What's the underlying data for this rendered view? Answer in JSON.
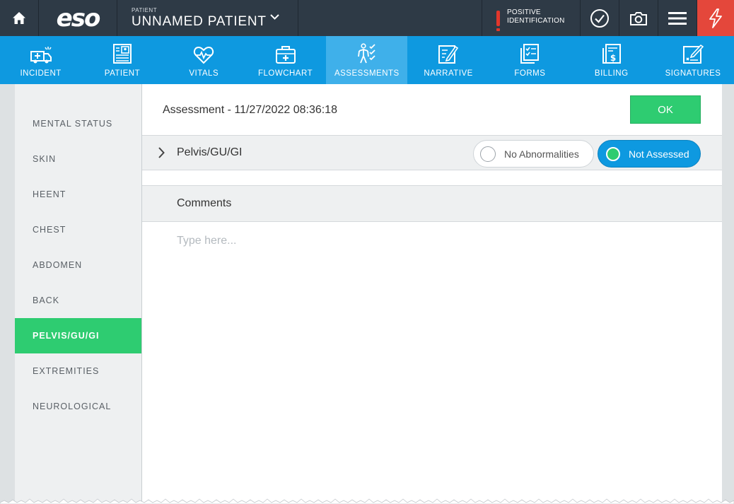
{
  "topbar": {
    "home_icon": "home-icon",
    "logo": "eso",
    "patient_label": "PATIENT",
    "patient_name": "UNNAMED PATIENT",
    "positive_id_line1": "POSITIVE",
    "positive_id_line2": "IDENTIFICATION",
    "icons": [
      "check-circle-icon",
      "camera-icon",
      "menu-icon",
      "lightning-icon"
    ],
    "bolt_color": "#e4473b"
  },
  "nav": {
    "items": [
      {
        "label": "INCIDENT",
        "icon": "ambulance-icon"
      },
      {
        "label": "PATIENT",
        "icon": "patient-card-icon"
      },
      {
        "label": "VITALS",
        "icon": "heartbeat-icon"
      },
      {
        "label": "FLOWCHART",
        "icon": "medkit-icon"
      },
      {
        "label": "ASSESSMENTS",
        "icon": "body-check-icon",
        "active": true
      },
      {
        "label": "NARRATIVE",
        "icon": "pencil-doc-icon"
      },
      {
        "label": "FORMS",
        "icon": "checklist-icon"
      },
      {
        "label": "BILLING",
        "icon": "dollar-doc-icon"
      },
      {
        "label": "SIGNATURES",
        "icon": "signature-icon"
      }
    ],
    "color": "#0e99e0"
  },
  "sidebar": {
    "items": [
      {
        "label": "MENTAL STATUS"
      },
      {
        "label": "SKIN"
      },
      {
        "label": "HEENT"
      },
      {
        "label": "CHEST"
      },
      {
        "label": "ABDOMEN"
      },
      {
        "label": "BACK"
      },
      {
        "label": "PELVIS/GU/GI",
        "active": true
      },
      {
        "label": "EXTREMITIES"
      },
      {
        "label": "NEUROLOGICAL"
      }
    ],
    "active_color": "#2ecc71"
  },
  "main": {
    "title": "Assessment - 11/27/2022 08:36:18",
    "ok_label": "OK",
    "section_label": "Pelvis/GU/GI",
    "options": {
      "no_abnormalities": "No Abnormalities",
      "not_assessed": "Not Assessed",
      "selected": "Not Assessed"
    },
    "comments_label": "Comments",
    "comments_placeholder": "Type here...",
    "comments_value": ""
  }
}
